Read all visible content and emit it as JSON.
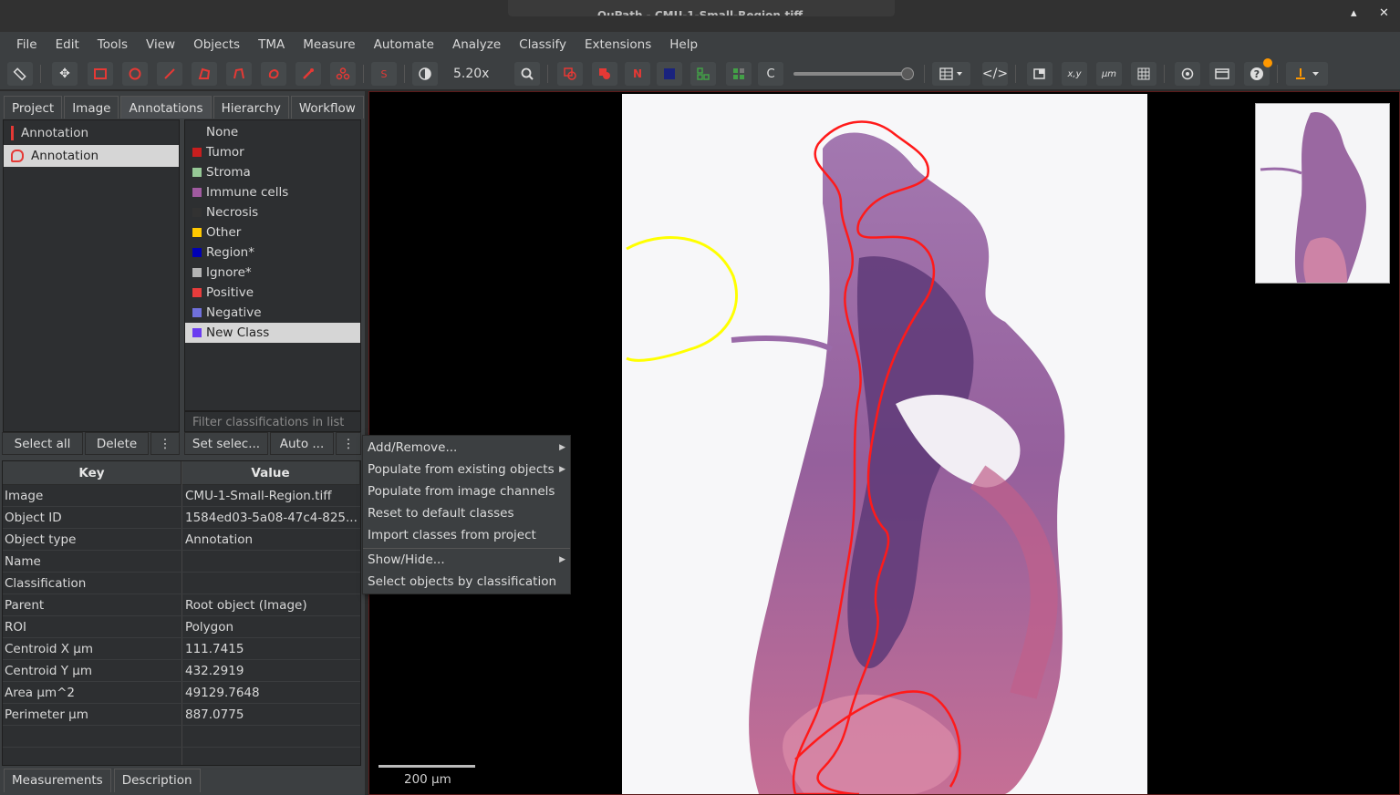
{
  "window": {
    "title": "QuPath - CMU-1-Small-Region.tiff",
    "minimize_glyph": "▴",
    "close_glyph": "✕"
  },
  "menubar": [
    "File",
    "Edit",
    "Tools",
    "View",
    "Objects",
    "TMA",
    "Measure",
    "Automate",
    "Analyze",
    "Classify",
    "Extensions",
    "Help"
  ],
  "toolbar": {
    "zoom": "5.20x",
    "s_label": "S",
    "n_label": "N",
    "c_label": "C",
    "xy_label": "x,y",
    "um_label": "µm",
    "colors": {
      "accent_red": "#e53935",
      "notification": "#ff9800"
    }
  },
  "left_tabs": [
    "Project",
    "Image",
    "Annotations",
    "Hierarchy",
    "Workflow"
  ],
  "annotations": [
    {
      "label": "Annotation",
      "selected": false
    },
    {
      "label": "Annotation",
      "selected": true
    }
  ],
  "classes": [
    {
      "label": "None",
      "color": ""
    },
    {
      "label": "Tumor",
      "color": "#c81e1e"
    },
    {
      "label": "Stroma",
      "color": "#96c896"
    },
    {
      "label": "Immune cells",
      "color": "#a05aa0"
    },
    {
      "label": "Necrosis",
      "color": "#323232"
    },
    {
      "label": "Other",
      "color": "#ffc800"
    },
    {
      "label": "Region*",
      "color": "#0000b4"
    },
    {
      "label": "Ignore*",
      "color": "#b4b4b4"
    },
    {
      "label": "Positive",
      "color": "#e83c3c"
    },
    {
      "label": "Negative",
      "color": "#7070dc"
    },
    {
      "label": "New Class",
      "color": "#6a3cf0"
    }
  ],
  "class_filter_placeholder": "Filter classifications in list",
  "ann_buttons": {
    "select_all": "Select all",
    "delete": "Delete",
    "more": "⋮"
  },
  "class_buttons": {
    "set_selected": "Set selec...",
    "auto": "Auto ...",
    "more": "⋮"
  },
  "properties": {
    "key_header": "Key",
    "value_header": "Value",
    "rows": [
      {
        "k": "Image",
        "v": "CMU-1-Small-Region.tiff"
      },
      {
        "k": "Object ID",
        "v": "1584ed03-5a08-47c4-825..."
      },
      {
        "k": "Object type",
        "v": "Annotation"
      },
      {
        "k": "Name",
        "v": ""
      },
      {
        "k": "Classification",
        "v": ""
      },
      {
        "k": "Parent",
        "v": "Root object (Image)"
      },
      {
        "k": "ROI",
        "v": "Polygon"
      },
      {
        "k": "Centroid X µm",
        "v": "111.7415"
      },
      {
        "k": "Centroid Y µm",
        "v": "432.2919"
      },
      {
        "k": "Area µm^2",
        "v": "49129.7648"
      },
      {
        "k": "Perimeter µm",
        "v": "887.0775"
      }
    ]
  },
  "bottom_tabs": [
    "Measurements",
    "Description"
  ],
  "viewer": {
    "scale_label": "200 µm"
  },
  "context_menu": [
    {
      "label": "Add/Remove...",
      "submenu": true
    },
    {
      "label": "Populate from existing objects",
      "submenu": true
    },
    {
      "label": "Populate from image channels",
      "submenu": false
    },
    {
      "label": "Reset to default classes",
      "submenu": false
    },
    {
      "label": "Import classes from project",
      "submenu": false
    },
    {
      "label": "Show/Hide...",
      "submenu": true
    },
    {
      "label": "Select objects by classification",
      "submenu": false
    }
  ]
}
